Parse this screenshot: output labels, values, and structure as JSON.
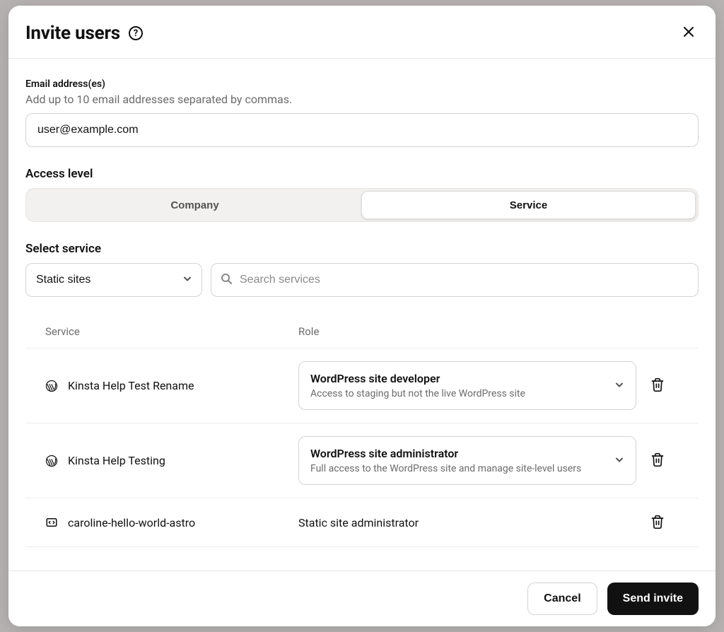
{
  "modal": {
    "title": "Invite users",
    "close_aria": "Close"
  },
  "email": {
    "label": "Email address(es)",
    "description": "Add up to 10 email addresses separated by commas.",
    "value": "user@example.com"
  },
  "access_level": {
    "label": "Access level",
    "options": [
      "Company",
      "Service"
    ],
    "selected": "Service"
  },
  "select_service": {
    "label": "Select service",
    "value": "Static sites"
  },
  "search": {
    "placeholder": "Search services"
  },
  "table": {
    "headers": {
      "service": "Service",
      "role": "Role"
    },
    "rows": [
      {
        "icon": "wordpress",
        "name": "Kinsta Help Test Rename",
        "role_type": "select",
        "role_title": "WordPress site developer",
        "role_desc": "Access to staging but not the live WordPress site"
      },
      {
        "icon": "wordpress",
        "name": "Kinsta Help Testing",
        "role_type": "select",
        "role_title": "WordPress site administrator",
        "role_desc": "Full access to the WordPress site and manage site-level users"
      },
      {
        "icon": "static-site",
        "name": "caroline-hello-world-astro",
        "role_type": "static",
        "role_title": "Static site administrator"
      }
    ]
  },
  "footer": {
    "cancel": "Cancel",
    "submit": "Send invite"
  }
}
